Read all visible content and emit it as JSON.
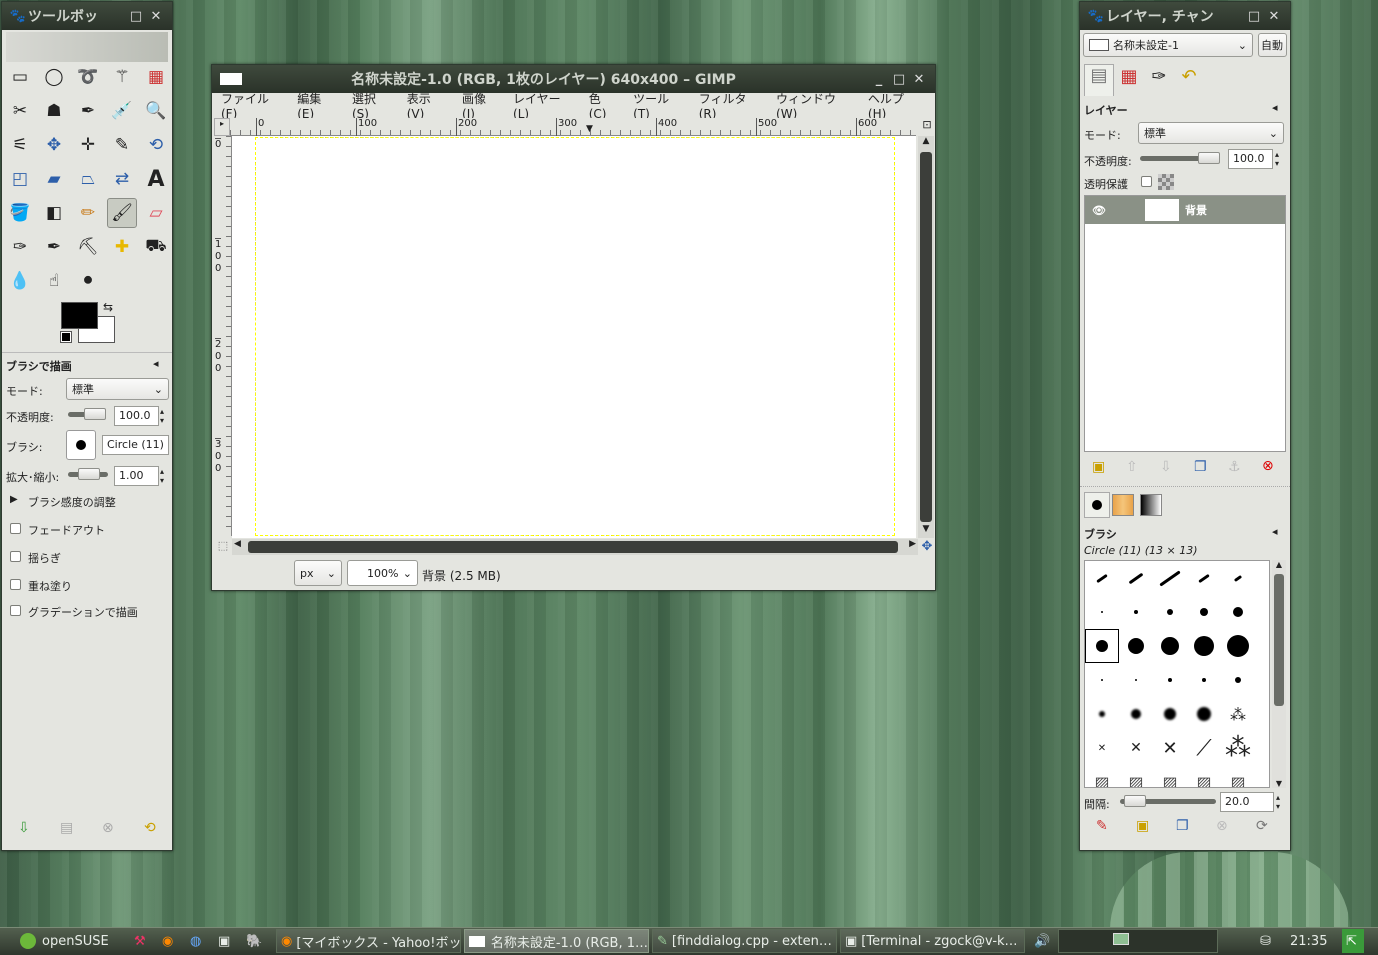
{
  "toolbox": {
    "title": "ツールボッ",
    "options_title": "ブラシで描画",
    "mode_label": "モード:",
    "mode_value": "標準",
    "opacity_label": "不透明度:",
    "opacity_value": "100.0",
    "opacity_level": 1.0,
    "brush_label": "ブラシ:",
    "brush_value": "Circle (11)",
    "scale_label": "拡大･縮小:",
    "scale_value": "1.00",
    "dynamics_label": "ブラシ感度の調整",
    "fade_label": "フェードアウト",
    "jitter_label": "揺らぎ",
    "incremental_label": "重ね塗り",
    "gradient_label": "グラデーションで描画",
    "fg_color": "#000000",
    "bg_color": "#ffffff"
  },
  "image": {
    "title": "名称未設定-1.0 (RGB, 1枚のレイヤー) 640x400 – GIMP",
    "menu": [
      "ファイル(F)",
      "編集(E)",
      "選択(S)",
      "表示(V)",
      "画像(I)",
      "レイヤー(L)",
      "色(C)",
      "ツール(T)",
      "フィルタ(R)",
      "ウィンドウ(W)",
      "ヘルプ(H)"
    ],
    "hruler": [
      "0",
      "100",
      "200",
      "300",
      "400",
      "500",
      "600"
    ],
    "vruler": [
      "0",
      "1\n0\n0",
      "2\n0\n0",
      "3\n0\n0"
    ],
    "unit": "px",
    "zoom": "100%",
    "status": "背景 (2.5 MB)"
  },
  "layers": {
    "title": "レイヤー, チャン",
    "image_combo": "名称未設定-1",
    "auto_button": "自動",
    "section": "レイヤー",
    "mode_label": "モード:",
    "mode_value": "標準",
    "opacity_label": "不透明度:",
    "opacity_value": "100.0",
    "lock_label": "透明保護",
    "layer_name": "背景",
    "brushes_section": "ブラシ",
    "brush_info": "Circle (11) (13 × 13)",
    "spacing_label": "間隔:",
    "spacing_value": "20.0"
  },
  "taskbar": {
    "start": "openSUSE",
    "tasks": [
      "[マイボックス - Yahoo!ボッ…",
      "名称未設定-1.0 (RGB, 1…",
      "[finddialog.cpp - exten…",
      "[Terminal - zgock@v-k…"
    ],
    "clock": "21:35"
  }
}
